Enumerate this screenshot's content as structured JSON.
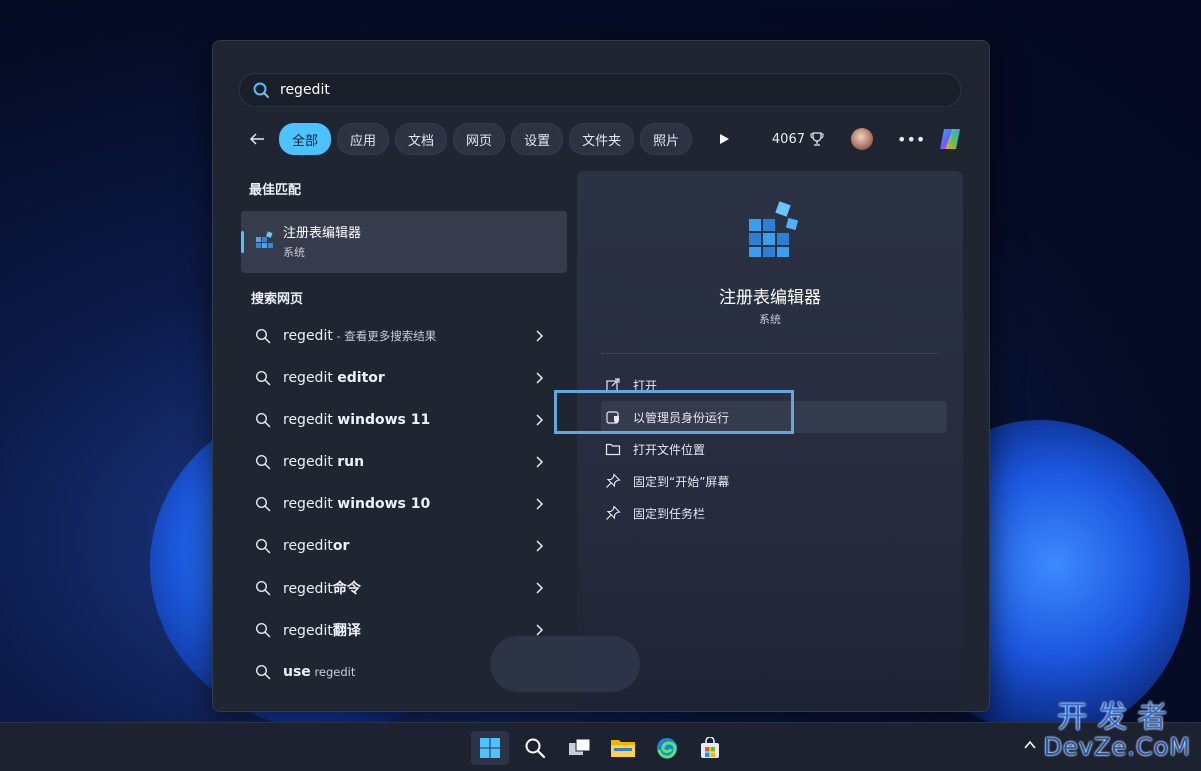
{
  "search": {
    "value": "regedit"
  },
  "filters": {
    "items": [
      "全部",
      "应用",
      "文档",
      "网页",
      "设置",
      "文件夹",
      "照片"
    ],
    "active_index": 0,
    "points": "4067"
  },
  "best_match": {
    "section_title": "最佳匹配",
    "name": "注册表编辑器",
    "subtitle": "系统"
  },
  "web_search": {
    "section_title": "搜索网页",
    "results": [
      {
        "prefix": "regedit",
        "bold": "",
        "suffix": " - 查看更多搜索结果",
        "chevron": true
      },
      {
        "prefix": "regedit ",
        "bold": "editor",
        "suffix": "",
        "chevron": true
      },
      {
        "prefix": "regedit ",
        "bold": "windows 11",
        "suffix": "",
        "chevron": true
      },
      {
        "prefix": "regedit ",
        "bold": "run",
        "suffix": "",
        "chevron": true
      },
      {
        "prefix": "regedit ",
        "bold": "windows 10",
        "suffix": "",
        "chevron": true
      },
      {
        "prefix": "regedit",
        "bold": "or",
        "suffix": "",
        "chevron": true
      },
      {
        "prefix": "regedit",
        "bold": "命令",
        "suffix": "",
        "chevron": true
      },
      {
        "prefix": "regedit",
        "bold": "翻译",
        "suffix": "",
        "chevron": true
      },
      {
        "prefix": "",
        "bold": "use",
        "suffix": " regedit",
        "chevron": false
      }
    ]
  },
  "detail": {
    "name": "注册表编辑器",
    "subtitle": "系统",
    "actions": [
      {
        "label": "打开",
        "icon": "open-external-icon"
      },
      {
        "label": "以管理员身份运行",
        "icon": "shield-admin-icon"
      },
      {
        "label": "打开文件位置",
        "icon": "folder-icon"
      },
      {
        "label": "固定到“开始”屏幕",
        "icon": "pin-icon"
      },
      {
        "label": "固定到任务栏",
        "icon": "pin-icon"
      }
    ]
  },
  "watermark": {
    "line1": "开发者",
    "line2": "DevZe.CoM"
  },
  "colors": {
    "accent": "#4cc2ff",
    "highlight_box": "#5fa8e0"
  }
}
